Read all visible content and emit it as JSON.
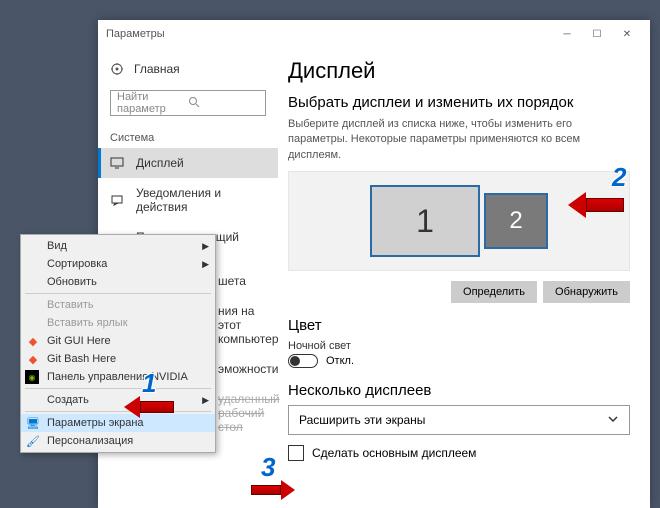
{
  "window": {
    "title": "Параметры"
  },
  "sidebar": {
    "home": "Главная",
    "search_placeholder": "Найти параметр",
    "section": "Система",
    "items": [
      {
        "label": "Дисплей"
      },
      {
        "label": "Уведомления и действия"
      },
      {
        "label": "Питание и спящий режим"
      },
      {
        "label_frag": "шета"
      },
      {
        "label_frag": "ния на этот компьютер"
      },
      {
        "label_frag": "эможности"
      },
      {
        "label_frag": "удаленный рабочий стол"
      }
    ]
  },
  "main": {
    "title": "Дисплей",
    "subtitle": "Выбрать дисплеи и изменить их порядок",
    "desc": "Выберите дисплей из списка ниже, чтобы изменить его параметры. Некоторые параметры применяются ко всем дисплеям.",
    "mon1": "1",
    "mon2": "2",
    "btn_identify": "Определить",
    "btn_detect": "Обнаружить",
    "color_title": "Цвет",
    "night_light": "Ночной свет",
    "toggle_off": "Откл.",
    "multi_title": "Несколько дисплеев",
    "dropdown": "Расширить эти экраны",
    "checkbox": "Сделать основным дисплеем"
  },
  "ctx": {
    "items": [
      {
        "label": "Вид",
        "sub": true
      },
      {
        "label": "Сортировка",
        "sub": true
      },
      {
        "label": "Обновить"
      },
      {
        "sep": true
      },
      {
        "label": "Вставить",
        "dis": true
      },
      {
        "label": "Вставить ярлык",
        "dis": true
      },
      {
        "label": "Git GUI Here",
        "icon": "git"
      },
      {
        "label": "Git Bash Here",
        "icon": "git"
      },
      {
        "label": "Панель управления NVIDIA",
        "icon": "nv"
      },
      {
        "sep": true
      },
      {
        "label": "Создать",
        "sub": true
      },
      {
        "sep": true
      },
      {
        "label": "Параметры экрана",
        "icon": "disp",
        "hl": true
      },
      {
        "label": "Персонализация",
        "icon": "pers"
      }
    ]
  },
  "annotations": {
    "n1": "1",
    "n2": "2",
    "n3": "3"
  }
}
